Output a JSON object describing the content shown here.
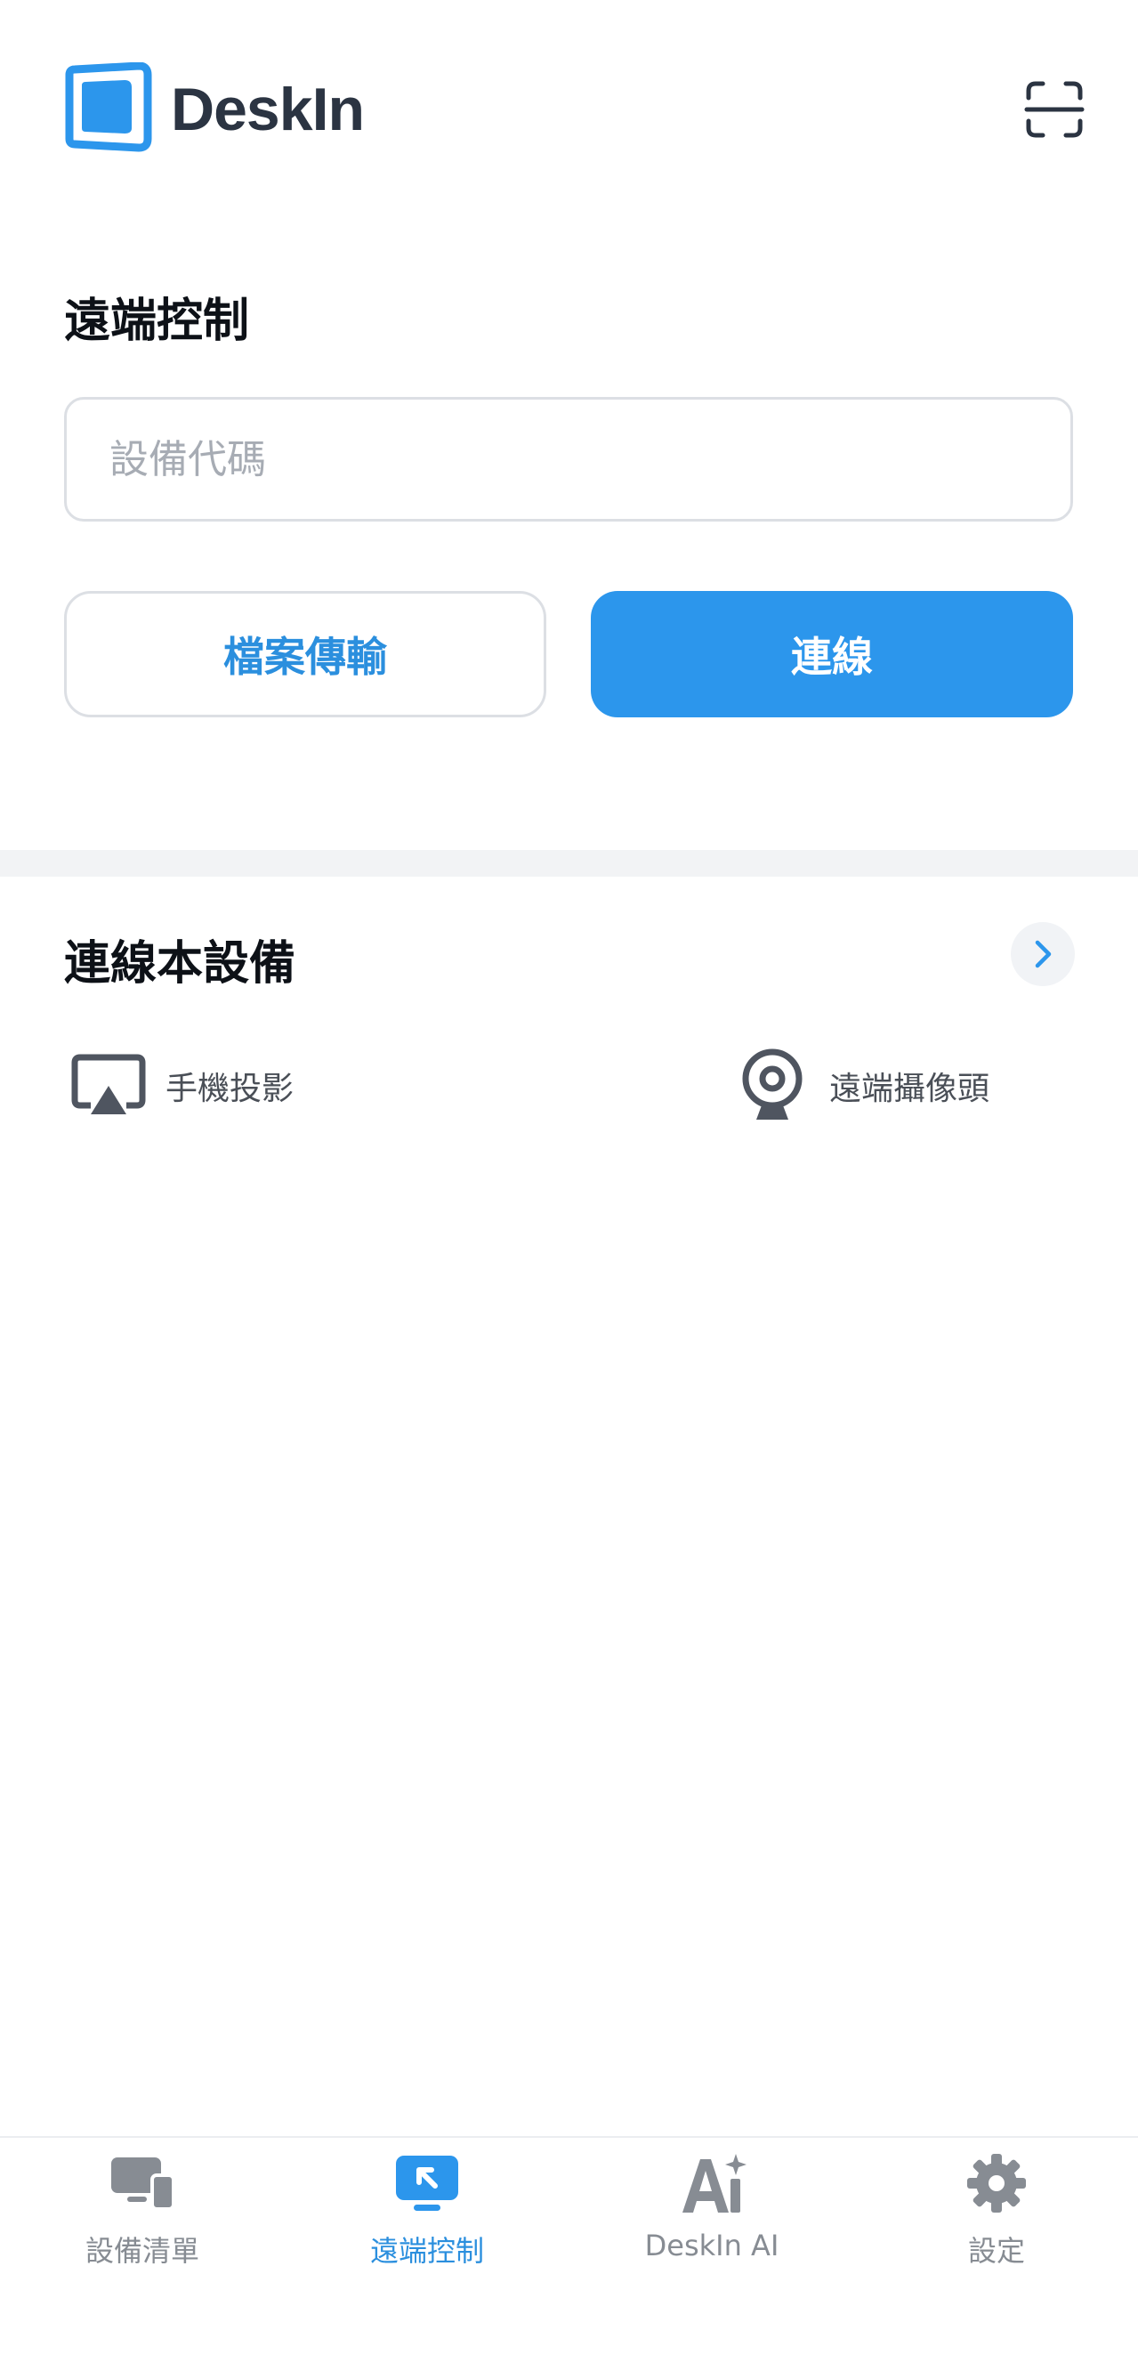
{
  "header": {
    "brand": "DeskIn",
    "icons": {
      "logo": "deskin-logo-icon",
      "scan": "scan-qr-icon"
    }
  },
  "remote_control": {
    "title": "遠端控制",
    "device_code_placeholder": "設備代碼",
    "device_code_value": "",
    "file_transfer_label": "檔案傳輸",
    "connect_label": "連線"
  },
  "connect_this_device": {
    "title": "連線本設備",
    "items": [
      {
        "label": "手機投影",
        "icon": "screen-mirror-icon"
      },
      {
        "label": "遠端攝像頭",
        "icon": "webcam-icon"
      }
    ]
  },
  "bottom_nav": {
    "items": [
      {
        "label": "設備清單",
        "icon": "devices-icon",
        "active": false
      },
      {
        "label": "遠端控制",
        "icon": "remote-control-icon",
        "active": true
      },
      {
        "label": "DeskIn AI",
        "icon": "ai-icon",
        "active": false
      },
      {
        "label": "設定",
        "icon": "gear-icon",
        "active": false
      }
    ]
  },
  "colors": {
    "accent": "#2c96ec",
    "accent_text": "#2b8fde",
    "nav_inactive": "#878c93",
    "divider": "#f2f3f5"
  }
}
